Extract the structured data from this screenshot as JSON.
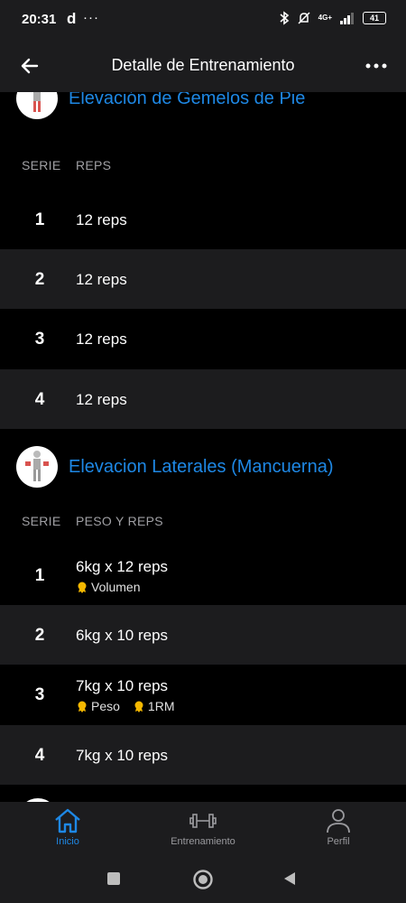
{
  "status_bar": {
    "time": "20:31",
    "carrier_glyph": "d",
    "more": "···",
    "network": "4G+",
    "battery": "41",
    "icons": [
      "bluetooth-icon",
      "mute-icon",
      "signal-icon",
      "battery-icon"
    ]
  },
  "app_bar": {
    "title": "Detalle de Entrenamiento",
    "back_icon": "back-arrow-icon",
    "more_icon": "more-dots-icon"
  },
  "exercises": [
    {
      "name": "Elevación de Gemelos de Pie",
      "col_serie": "SERIE",
      "col_value": "REPS",
      "sets": [
        {
          "num": "1",
          "value": "12 reps",
          "badges": []
        },
        {
          "num": "2",
          "value": "12 reps",
          "badges": []
        },
        {
          "num": "3",
          "value": "12 reps",
          "badges": []
        },
        {
          "num": "4",
          "value": "12 reps",
          "badges": []
        }
      ]
    },
    {
      "name": "Elevacion Laterales (Mancuerna)",
      "col_serie": "SERIE",
      "col_value": "PESO Y REPS",
      "sets": [
        {
          "num": "1",
          "value": "6kg x 12 reps",
          "badges": [
            "Volumen"
          ]
        },
        {
          "num": "2",
          "value": "6kg x 10 reps",
          "badges": []
        },
        {
          "num": "3",
          "value": "7kg x 10 reps",
          "badges": [
            "Peso",
            "1RM"
          ]
        },
        {
          "num": "4",
          "value": "7kg x 10 reps",
          "badges": []
        }
      ]
    }
  ],
  "bottom_nav": {
    "items": [
      {
        "label": "Inicio",
        "icon": "home-icon",
        "active": true
      },
      {
        "label": "Entrenamiento",
        "icon": "dumbbell-icon",
        "active": false
      },
      {
        "label": "Perfil",
        "icon": "person-icon",
        "active": false
      }
    ]
  },
  "colors": {
    "accent": "#1e88e5",
    "background": "#000000",
    "surface": "#1c1c1e",
    "medal": "#f5b800"
  }
}
